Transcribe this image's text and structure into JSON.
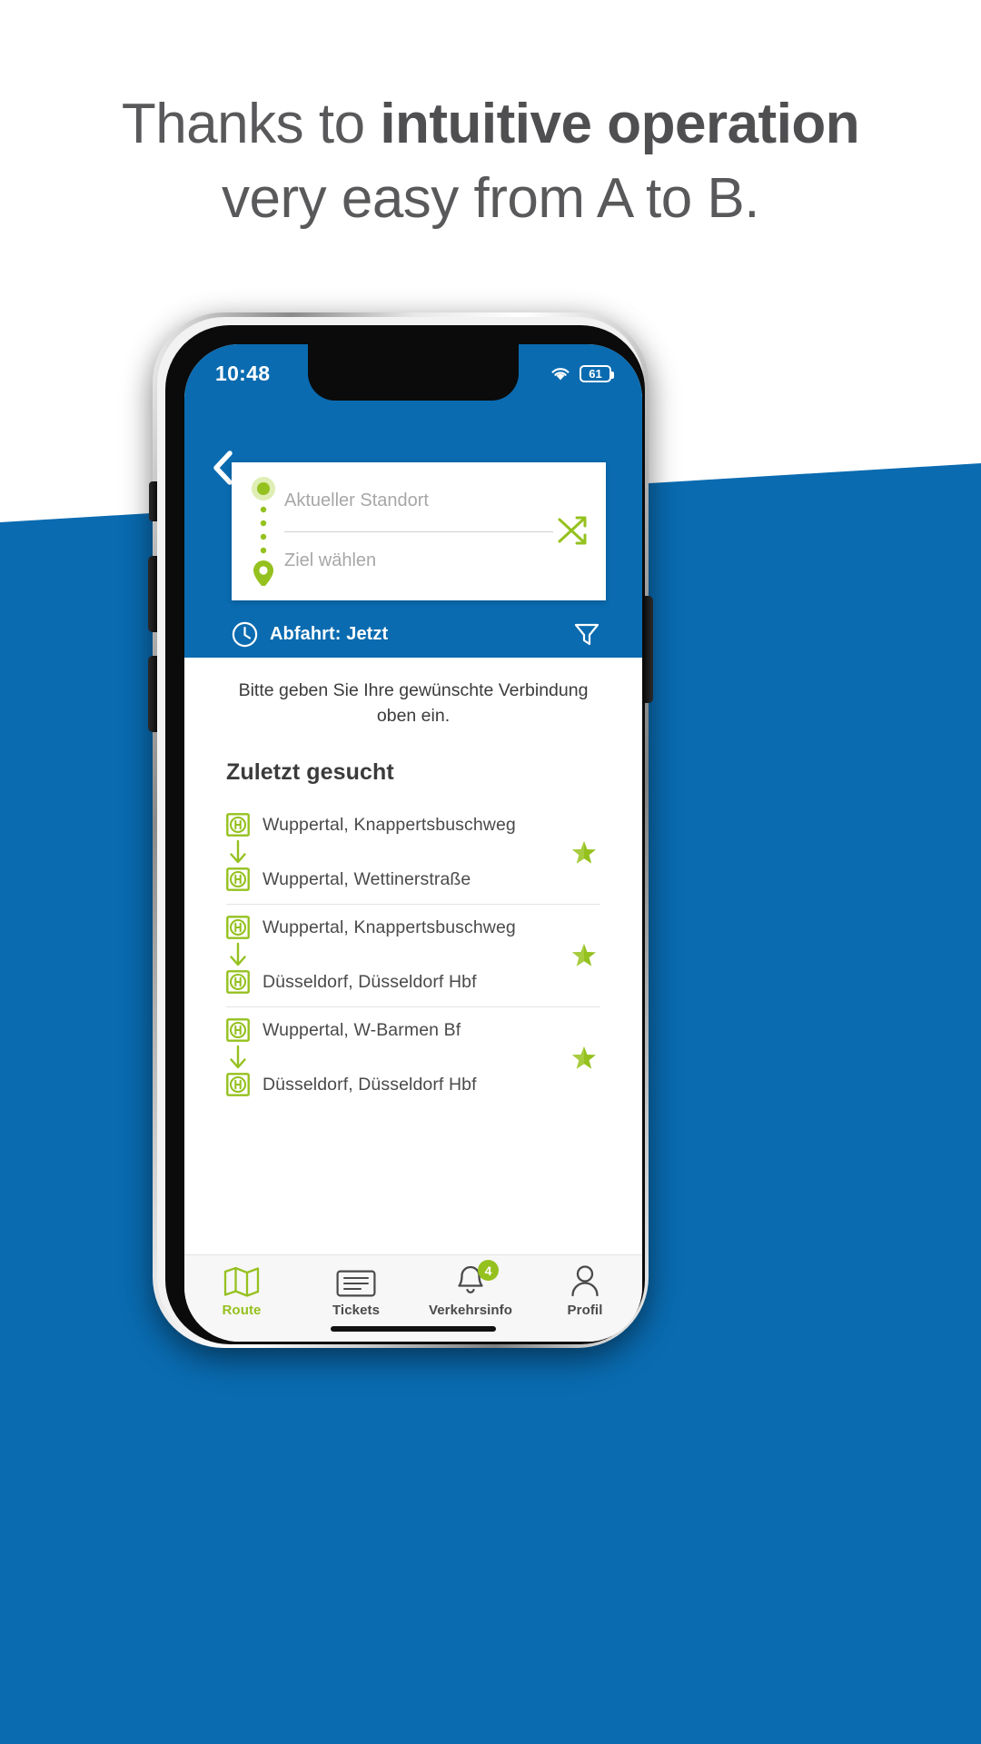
{
  "promo": {
    "line1_plain": "Thanks to ",
    "line1_bold": "intuitive operation",
    "line2": "very easy from A to B."
  },
  "colors": {
    "brand_blue": "#0a6bb0",
    "accent_green": "#95c11f",
    "text_grey": "#59595b"
  },
  "phone": {
    "statusbar": {
      "time": "10:48",
      "wifi_icon": "wifi-icon",
      "battery_icon": "battery-icon",
      "battery_level": "61"
    },
    "header": {
      "back_icon": "back-chevron-icon",
      "origin_placeholder": "Aktueller Standort",
      "destination_placeholder": "Ziel wählen",
      "origin_icon": "current-location-dot-icon",
      "destination_icon": "map-pin-icon",
      "swap_icon": "swap-arrows-icon",
      "clock_icon": "clock-icon",
      "departure_label": "Abfahrt: Jetzt",
      "filter_icon": "filter-funnel-icon"
    },
    "content": {
      "hint": "Bitte geben Sie Ihre gewünschte Verbindung oben ein.",
      "recent_title": "Zuletzt gesucht",
      "stop_icon": "h-stop-icon",
      "arrow_icon": "arrow-down-icon",
      "favorite_icon": "favorite-star-icon",
      "recent_searches": [
        {
          "from": "Wuppertal, Knappertsbuschweg",
          "to": "Wuppertal, Wettinerstraße"
        },
        {
          "from": "Wuppertal, Knappertsbuschweg",
          "to": "Düsseldorf, Düsseldorf Hbf"
        },
        {
          "from": "Wuppertal, W-Barmen Bf",
          "to": "Düsseldorf, Düsseldorf Hbf"
        }
      ]
    },
    "tabbar": {
      "tabs": [
        {
          "label": "Route",
          "icon": "map-icon",
          "active": true,
          "badge": ""
        },
        {
          "label": "Tickets",
          "icon": "ticket-icon",
          "active": false,
          "badge": ""
        },
        {
          "label": "Verkehrsinfo",
          "icon": "bell-icon",
          "active": false,
          "badge": "4"
        },
        {
          "label": "Profil",
          "icon": "person-icon",
          "active": false,
          "badge": ""
        }
      ]
    }
  }
}
